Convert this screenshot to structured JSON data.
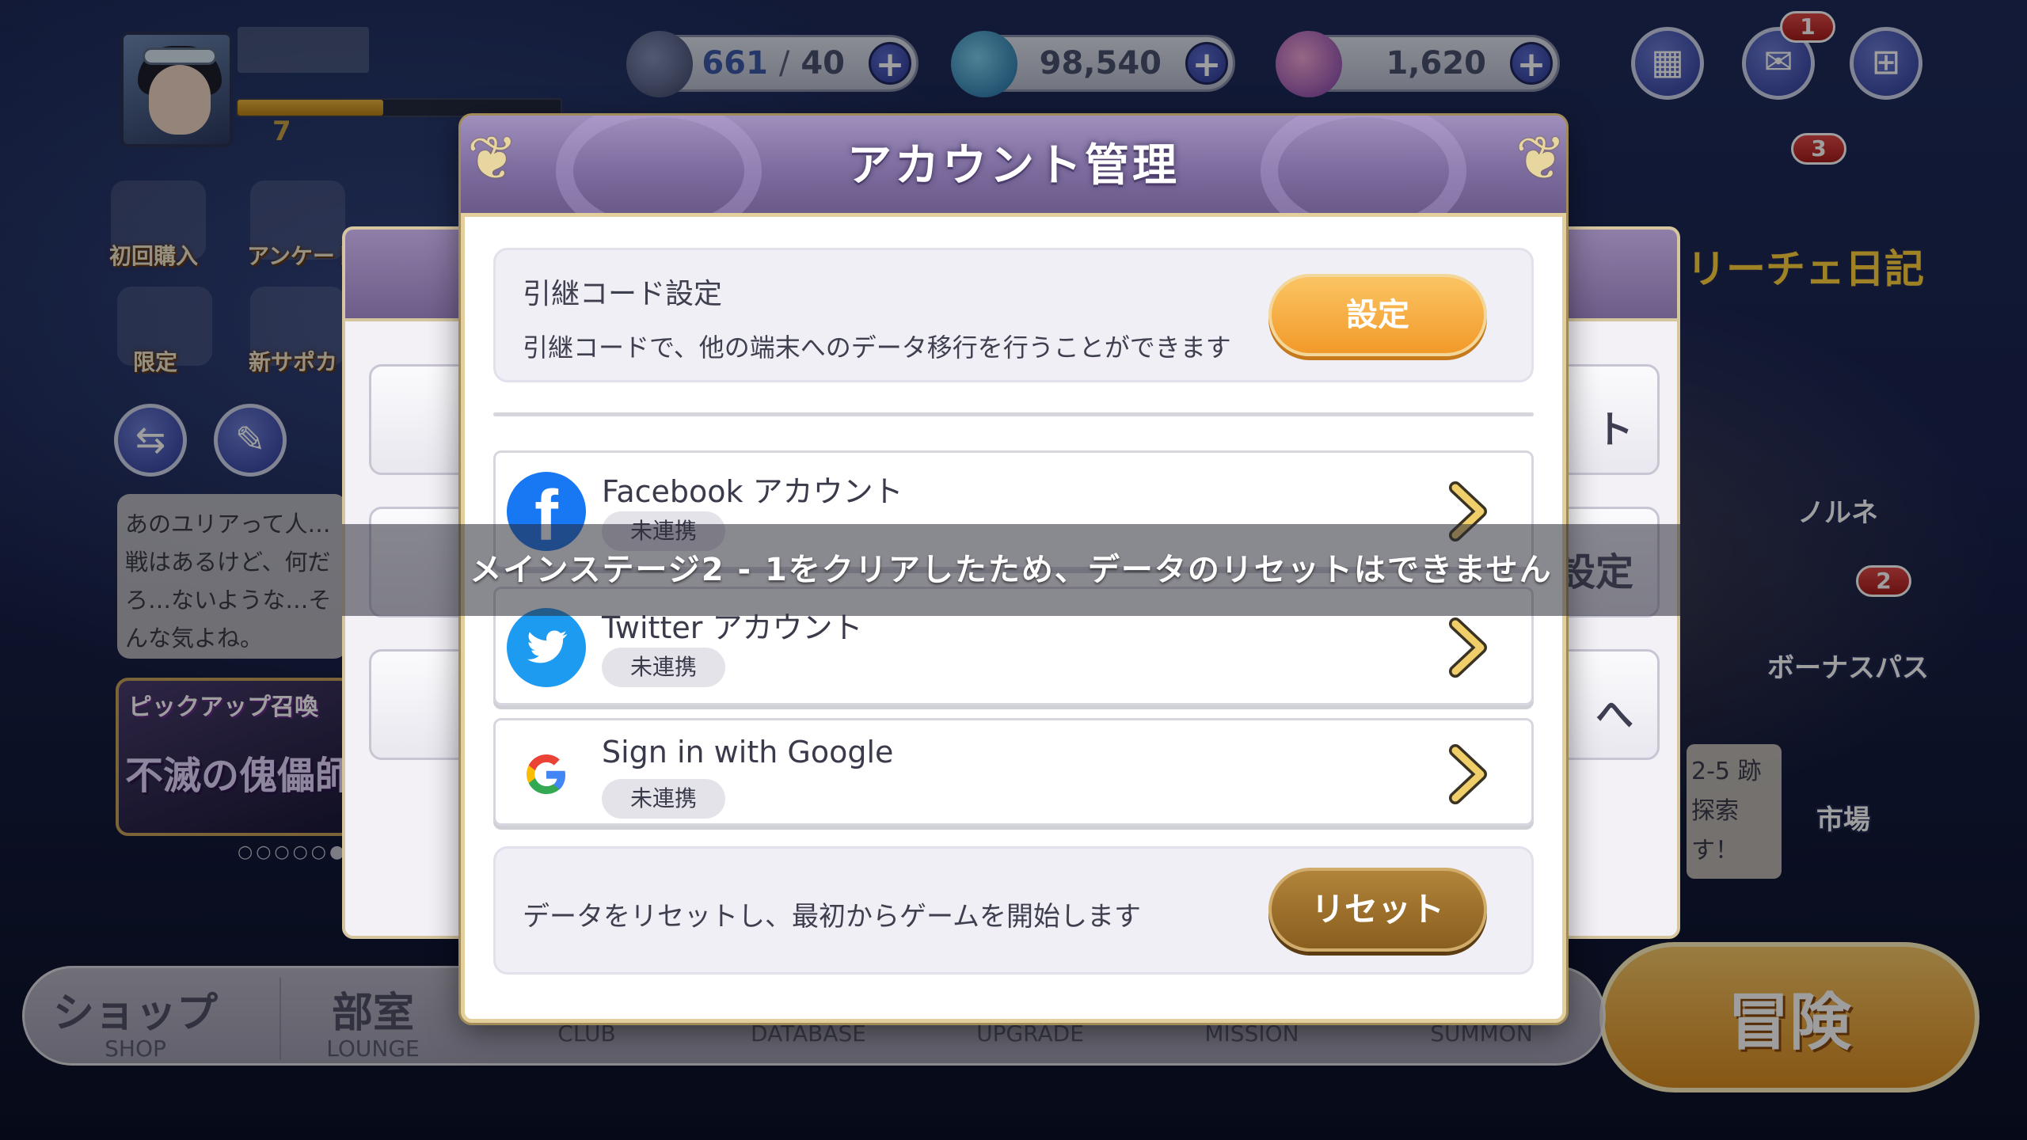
{
  "player": {
    "level": "7",
    "xp_fraction": 0.45
  },
  "resources": {
    "stamina_current": "661",
    "stamina_sep": "/",
    "stamina_max": "40",
    "gold": "98,540",
    "gems": "1,620",
    "plus": "+"
  },
  "hud": {
    "mail_badge": "1",
    "side_badge": "3",
    "bonus_badge": "2"
  },
  "left_menu": {
    "first_purchase": "初回購入",
    "survey": "アンケート",
    "limited": "限定",
    "new_support": "新サポカ",
    "chat_text": "あのユリアって人…戦はあるけど、何だろ…ないような…そんな気よね。",
    "pickup_title": "ピックアップ召喚",
    "pickup_name": "不滅の傀儡師",
    "carousel_dots": "○○○○○●"
  },
  "right_menu": {
    "diary": "リーチェ日記",
    "norune": "ノルネ",
    "bonus_pass": "ボーナスパス",
    "market": "市場",
    "quest_text": "2-5 跡探索 す！",
    "adventure": "冒険"
  },
  "bottom_nav": [
    {
      "jp": "ショップ",
      "en": "SHOP"
    },
    {
      "jp": "部室",
      "en": "LOUNGE"
    },
    {
      "jp": "",
      "en": "CLUB"
    },
    {
      "jp": "",
      "en": "DATABASE"
    },
    {
      "jp": "",
      "en": "UPGRADE"
    },
    {
      "jp": "",
      "en": "MISSION"
    },
    {
      "jp": "",
      "en": "SUMMON"
    }
  ],
  "back_dialog": {
    "row1": "ト",
    "row2": "設定",
    "row3": "へ"
  },
  "modal": {
    "title": "アカウント管理",
    "transfer": {
      "title": "引継コード設定",
      "desc": "引継コードで、他の端末へのデータ移行を行うことができます",
      "button": "設定"
    },
    "links": [
      {
        "title": "Facebook アカウント",
        "status": "未連携"
      },
      {
        "title": "Twitter アカウント",
        "status": "未連携"
      },
      {
        "title": "Sign in with Google",
        "status": "未連携"
      }
    ],
    "reset": {
      "desc": "データをリセットし、最初からゲームを開始します",
      "button": "リセット"
    }
  },
  "toast": "メインステージ2 - 1をクリアしたため、データのリセットはできません",
  "colors": {
    "header_purple": "#7d6c9e",
    "gold_border": "#e2cf9c",
    "orange_button": "#f29a2a",
    "brown_button": "#8a5e1e",
    "facebook": "#1877f2",
    "twitter": "#1d9bf0"
  }
}
